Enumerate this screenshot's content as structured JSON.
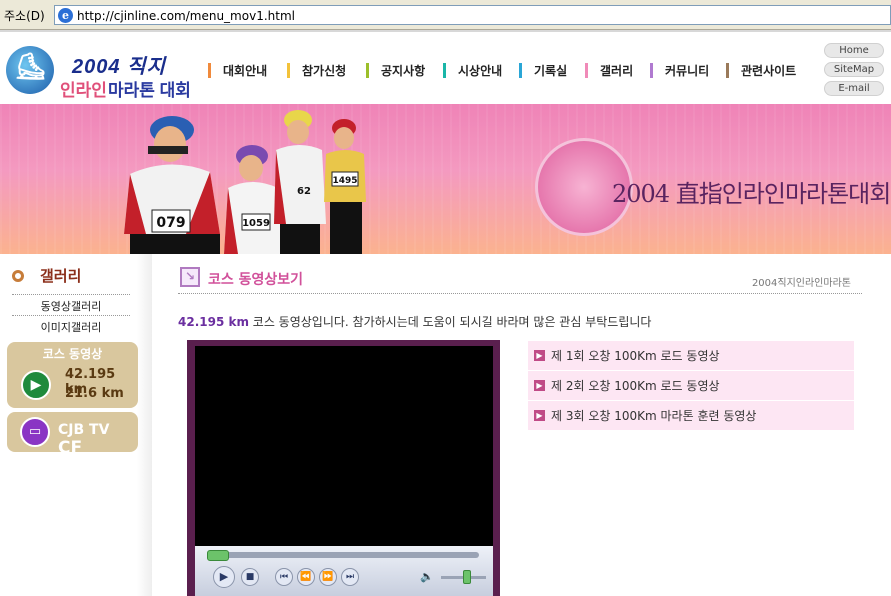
{
  "address_bar": {
    "label": "주소(D)",
    "url": "http://cjinline.com/menu_mov1.html"
  },
  "header": {
    "logo": {
      "year": "2004 직지",
      "subtitle_part1": "인라인",
      "subtitle_part2": "마라톤 대회"
    },
    "nav": [
      {
        "label": "대회안내",
        "color": "#f08a3c"
      },
      {
        "label": "참가신청",
        "color": "#f3c23a"
      },
      {
        "label": "공지사항",
        "color": "#9cbf2a"
      },
      {
        "label": "시상안내",
        "color": "#1ab6a8"
      },
      {
        "label": "기록실",
        "color": "#2aa6d6"
      },
      {
        "label": "갤러리",
        "color": "#f08ab8"
      },
      {
        "label": "커뮤니티",
        "color": "#b07ad0"
      },
      {
        "label": "관련사이트",
        "color": "#9a7a5a"
      }
    ],
    "utility": [
      "Home",
      "SiteMap",
      "E-mail"
    ]
  },
  "banner": {
    "title": "2004 直指인라인마라톤대회",
    "bib_numbers": [
      "079",
      "1059",
      "62",
      "1495"
    ]
  },
  "sidebar": {
    "title": "갤러리",
    "links": [
      "동영상갤러리",
      "이미지갤러리"
    ],
    "course_box": {
      "title": "코스 동영상",
      "distance_1": "42.195 km",
      "distance_2": "21.6  km"
    },
    "tv_box": {
      "label": "CJB TV",
      "label_suffix": "CF"
    }
  },
  "content": {
    "title": "코스 동영상보기",
    "breadcrumb": "2004직지인라인마라톤",
    "intro_distance": "42.195 km",
    "intro_text": " 코스 동영상입니다. 참가하시는데 도움이 되시길 바라며 많은 관심 부탁드립니다",
    "videos": [
      "제 1회 오창 100Km 로드 동영상",
      "제 2회 오창 100Km 로드 동영상",
      "제 3회 오창 100Km 마라톤 훈련 동영상"
    ],
    "player": {
      "progress": 0.0,
      "volume": 0.6
    }
  }
}
